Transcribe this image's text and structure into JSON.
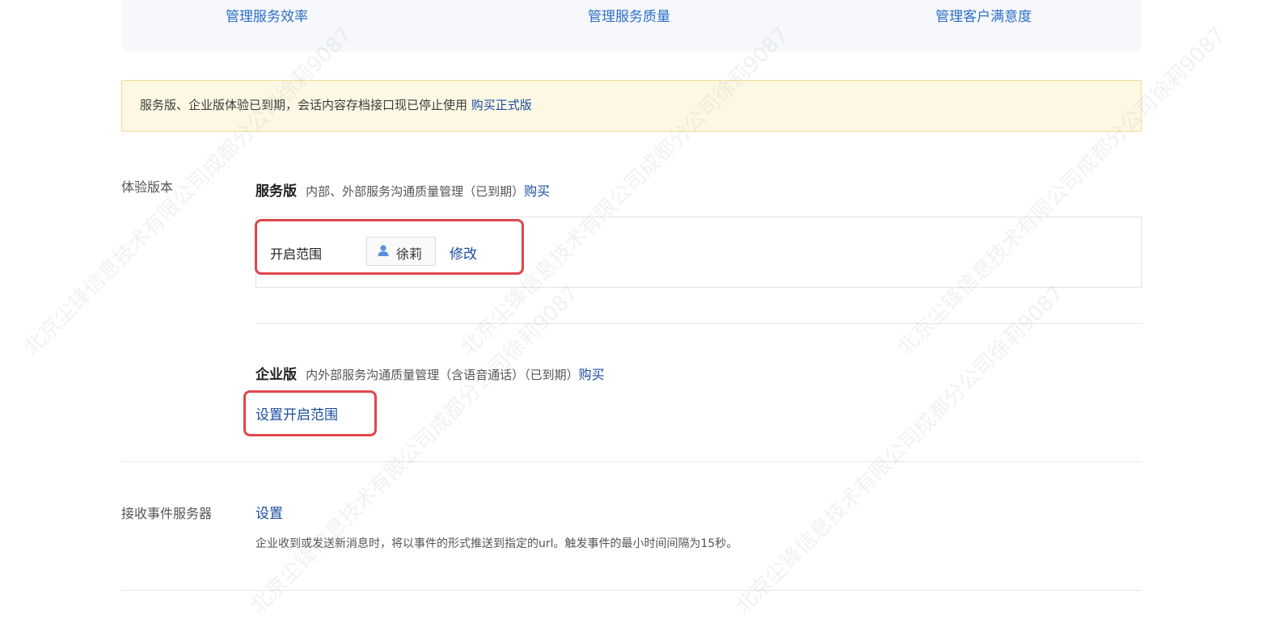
{
  "top_tabs": [
    {
      "label": "管理服务效率"
    },
    {
      "label": "管理服务质量"
    },
    {
      "label": "管理客户满意度"
    }
  ],
  "warning": {
    "text": "服务版、企业版体验已到期，会话内容存档接口现已停止使用 ",
    "link": "购买正式版"
  },
  "trial_section": {
    "label": "体验版本",
    "service_edition": {
      "title": "服务版",
      "desc": "内部、外部服务沟通质量管理（已到期）",
      "buy": "购买",
      "scope_label": "开启范围",
      "user_name": "徐莉",
      "modify": "修改"
    },
    "enterprise_edition": {
      "title": "企业版",
      "desc": "内外部服务沟通质量管理（含语音通话）（已到期）",
      "buy": "购买",
      "set_scope": "设置开启范围"
    }
  },
  "event_server": {
    "label": "接收事件服务器",
    "setting": "设置",
    "desc": "企业收到或发送新消息时，将以事件的形式推送到指定的url。触发事件的最小时间间隔为15秒。"
  },
  "watermark": {
    "text": "北京尘锋信息技术有限公司成都分公司徐莉9087"
  },
  "colors": {
    "link": "#1b4d9e",
    "tab_link": "#2d6fc8",
    "highlight_box": "#e0474b",
    "warning_bg": "#fdf8e4",
    "warning_border": "#f3dc94"
  }
}
